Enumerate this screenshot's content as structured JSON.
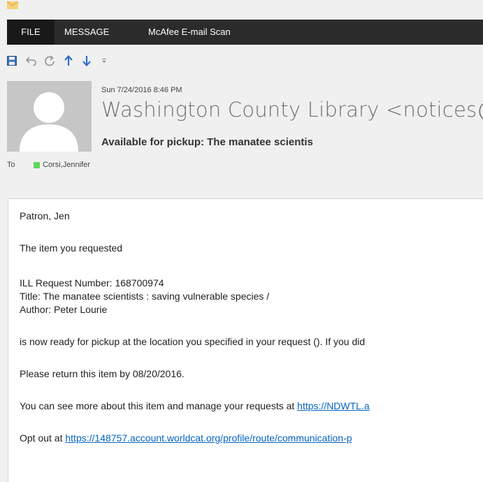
{
  "ribbon": {
    "tabs": [
      {
        "label": "FILE"
      },
      {
        "label": "MESSAGE"
      },
      {
        "label": "McAfee E-mail Scan"
      }
    ]
  },
  "quick_access": {
    "buttons": [
      "save-icon",
      "undo-icon",
      "redo-icon",
      "previous-item-icon",
      "next-item-icon",
      "customize-dropdown-icon"
    ]
  },
  "header": {
    "date": "Sun 7/24/2016 8:46 PM",
    "from": "Washington County Library <notices@e.w",
    "subject": "Available for pickup: The manatee scientis",
    "to_label": "To",
    "recipient": "Corsi,Jennifer",
    "presence_color": "#5cd65c"
  },
  "body": {
    "greeting": "Patron, Jen",
    "intro": "The item you requested",
    "request_number": "ILL Request Number: 168700974",
    "title": "Title: The manatee scientists : saving vulnerable species /",
    "author": "Author: Peter Lourie",
    "ready": "is now ready for pickup at the location you specified in your request ().  If you did",
    "return_by": "Please return this item by 08/20/2016.",
    "see_more_prefix": "You can see more about this item and manage your requests at ",
    "see_more_link": "https://NDWTL.a",
    "opt_out_prefix": "Opt out at ",
    "opt_out_link": "https://148757.account.worldcat.org/profile/route/communication-p"
  }
}
